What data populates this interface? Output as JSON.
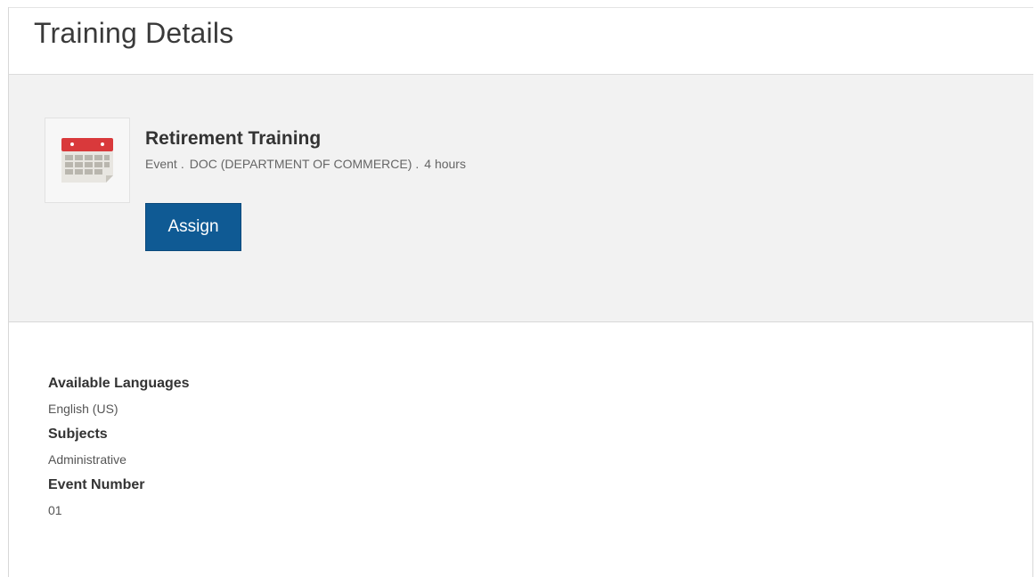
{
  "header": {
    "title": "Training Details"
  },
  "course": {
    "icon": "calendar-icon",
    "title": "Retirement Training",
    "meta": {
      "type": "Event",
      "provider": "DOC (DEPARTMENT OF COMMERCE)",
      "duration": "4 hours",
      "separator": "."
    },
    "assign_label": "Assign"
  },
  "details": {
    "fields": [
      {
        "label": "Available Languages",
        "value": "English (US)"
      },
      {
        "label": "Subjects",
        "value": "Administrative"
      },
      {
        "label": "Event Number",
        "value": "01"
      }
    ]
  },
  "colors": {
    "button": "#0f5a94",
    "banner": "#f2f2f2",
    "calendar_header": "#d9393b"
  }
}
